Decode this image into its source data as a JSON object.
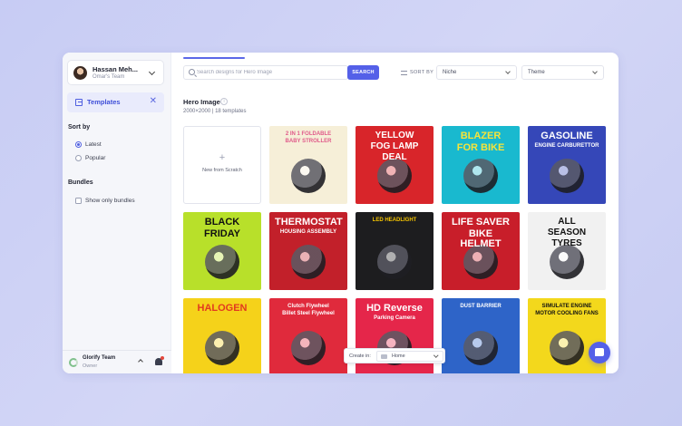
{
  "user": {
    "name": "Hassan Meh...",
    "team": "Omar's Team"
  },
  "nav": {
    "templates_label": "Templates",
    "close_glyph": "✕"
  },
  "sort": {
    "title": "Sort by",
    "options": [
      "Latest",
      "Popular"
    ],
    "selected": "Latest"
  },
  "bundles": {
    "title": "Bundles",
    "checkbox_label": "Show only bundles",
    "checked": false
  },
  "workspace": {
    "name": "Glorify Team",
    "role": "Owner"
  },
  "search": {
    "placeholder": "Search designs for Hero Image",
    "button_label": "SEARCH"
  },
  "filters": {
    "sort_label": "SORT BY",
    "niche_value": "Niche",
    "theme_value": "Theme"
  },
  "page": {
    "title": "Hero Image",
    "subtitle": "2000×2000 | 18 templates"
  },
  "new_card": {
    "plus": "+",
    "label": "New from Scratch"
  },
  "templates": [
    {
      "name": "stroller",
      "lines": [
        "2 IN 1 FOLDABLE",
        "BABY STROLLER"
      ],
      "bg": "#f6efd8",
      "fg": "#e05a8a"
    },
    {
      "name": "yellow-fog-lamp",
      "lines": [
        "YELLOW",
        "FOG LAMP",
        "DEAL"
      ],
      "bg": "#d8252a",
      "fg": "#ffffff"
    },
    {
      "name": "blazer-bike",
      "lines": [
        "BLAZER",
        "FOR BIKE"
      ],
      "bg": "#19b9cf",
      "fg": "#f7e43a"
    },
    {
      "name": "carburettor",
      "lines": [
        "GASOLINE",
        "ENGINE CARBURETTOR"
      ],
      "bg": "#3547b8",
      "fg": "#ffffff"
    },
    {
      "name": "black-friday",
      "lines": [
        "BLACK",
        "FRIDAY"
      ],
      "bg": "#b8e02a",
      "fg": "#111111"
    },
    {
      "name": "thermostat",
      "lines": [
        "THERMOSTAT",
        "HOUSING ASSEMBLY"
      ],
      "bg": "#c2202a",
      "fg": "#ffffff"
    },
    {
      "name": "led-headlight",
      "lines": [
        "LED HEADLIGHT"
      ],
      "bg": "#1d1d1f",
      "fg": "#f5c400"
    },
    {
      "name": "bike-helmet",
      "lines": [
        "LIFE SAVER",
        "BIKE HELMET"
      ],
      "bg": "#c81e2a",
      "fg": "#ffffff"
    },
    {
      "name": "all-season-tyres",
      "lines": [
        "ALL",
        "SEASON",
        "TYRES"
      ],
      "bg": "#f1f1f1",
      "fg": "#111111"
    },
    {
      "name": "halogen",
      "lines": [
        "HALOGEN"
      ],
      "bg": "#f5d21a",
      "fg": "#e23a1f"
    },
    {
      "name": "flywheel",
      "lines": [
        "Clutch Flywheel",
        "Billet Steel Flywheel"
      ],
      "bg": "#e02a3c",
      "fg": "#ffffff"
    },
    {
      "name": "parking-camera",
      "lines": [
        "HD Reverse",
        "Parking Camera"
      ],
      "bg": "#e5264a",
      "fg": "#ffffff"
    },
    {
      "name": "dust-barrier",
      "lines": [
        "DUST BARRIER"
      ],
      "bg": "#2e64c8",
      "fg": "#ffffff"
    },
    {
      "name": "cooling-fans",
      "lines": [
        "SIMULATE ENGINE",
        "MOTOR COOLING FANS"
      ],
      "bg": "#f3d81c",
      "fg": "#111111"
    }
  ],
  "create_in": {
    "label": "Create in:",
    "value": "Home"
  },
  "colors": {
    "accent": "#5460e8",
    "page_bg": "#c9cdf3"
  }
}
